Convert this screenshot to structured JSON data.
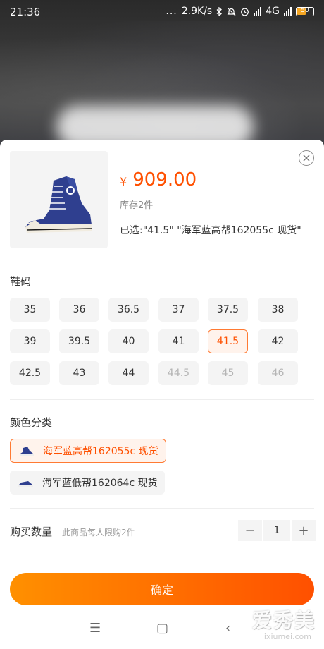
{
  "status_bar": {
    "time": "21:36",
    "dots": "...",
    "network_speed": "2.9K/s",
    "network_type": "4G",
    "battery_level": "50"
  },
  "product": {
    "currency_symbol": "¥",
    "price": "909.00",
    "stock": "库存2件",
    "selected_text": "已选:\"41.5\" \"海军蓝高帮162055c 现货\"",
    "close_icon": "close-circle-icon"
  },
  "size_section": {
    "title": "鞋码",
    "sizes": [
      {
        "label": "35",
        "state": "normal"
      },
      {
        "label": "36",
        "state": "normal"
      },
      {
        "label": "36.5",
        "state": "normal"
      },
      {
        "label": "37",
        "state": "normal"
      },
      {
        "label": "37.5",
        "state": "normal"
      },
      {
        "label": "38",
        "state": "normal"
      },
      {
        "label": "39",
        "state": "normal"
      },
      {
        "label": "39.5",
        "state": "normal"
      },
      {
        "label": "40",
        "state": "normal"
      },
      {
        "label": "41",
        "state": "normal"
      },
      {
        "label": "41.5",
        "state": "selected"
      },
      {
        "label": "42",
        "state": "normal"
      },
      {
        "label": "42.5",
        "state": "normal"
      },
      {
        "label": "43",
        "state": "normal"
      },
      {
        "label": "44",
        "state": "normal"
      },
      {
        "label": "44.5",
        "state": "disabled"
      },
      {
        "label": "45",
        "state": "disabled"
      },
      {
        "label": "46",
        "state": "disabled"
      }
    ]
  },
  "color_section": {
    "title": "颜色分类",
    "options": [
      {
        "label": "海军蓝高帮162055c 现货",
        "state": "selected"
      },
      {
        "label": "海军蓝低帮162064c 现货",
        "state": "normal"
      }
    ]
  },
  "quantity": {
    "label": "购买数量",
    "note": "此商品每人限购2件",
    "value": "1",
    "minus": "−",
    "plus": "+"
  },
  "confirm_label": "确定",
  "nav": {
    "menu_icon": "☰",
    "home_icon": "▢",
    "back_icon": "‹"
  },
  "watermark": {
    "text": "爱秀美",
    "sub": "ixiumei.com"
  },
  "colors": {
    "accent": "#ff5000",
    "accent_gradient_start": "#ff9000",
    "chip_bg": "#f4f4f4",
    "selected_chip_bg": "#fff3ec"
  }
}
